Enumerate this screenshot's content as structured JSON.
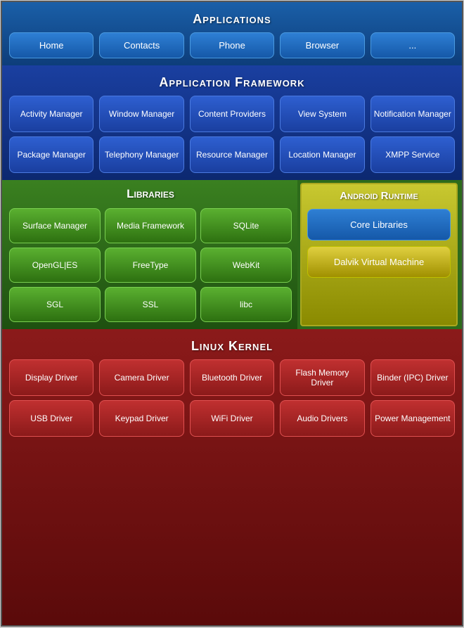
{
  "applications": {
    "title": "Applications",
    "buttons": [
      "Home",
      "Contacts",
      "Phone",
      "Browser",
      "..."
    ]
  },
  "framework": {
    "title": "Application Framework",
    "row1": [
      "Activity\nManager",
      "Window\nManager",
      "Content\nProviders",
      "View\nSystem",
      "Notification\nManager"
    ],
    "row2": [
      "Package\nManager",
      "Telephony\nManager",
      "Resource\nManager",
      "Location\nManager",
      "XMPP\nService"
    ]
  },
  "libraries": {
    "title": "Libraries",
    "row1": [
      "Surface\nManager",
      "Media\nFramework",
      "SQLite"
    ],
    "row2": [
      "OpenGL|ES",
      "FreeType",
      "WebKit"
    ],
    "row3": [
      "SGL",
      "SSL",
      "libc"
    ]
  },
  "android_runtime": {
    "title": "Android Runtime",
    "btn1": "Core\nLibraries",
    "btn2": "Dalvik Virtual\nMachine"
  },
  "kernel": {
    "title": "Linux Kernel",
    "row1": [
      "Display\nDriver",
      "Camera\nDriver",
      "Bluetooth\nDriver",
      "Flash Memory\nDriver",
      "Binder (IPC)\nDriver"
    ],
    "row2": [
      "USB\nDriver",
      "Keypad\nDriver",
      "WiFi\nDriver",
      "Audio\nDrivers",
      "Power\nManagement"
    ]
  }
}
